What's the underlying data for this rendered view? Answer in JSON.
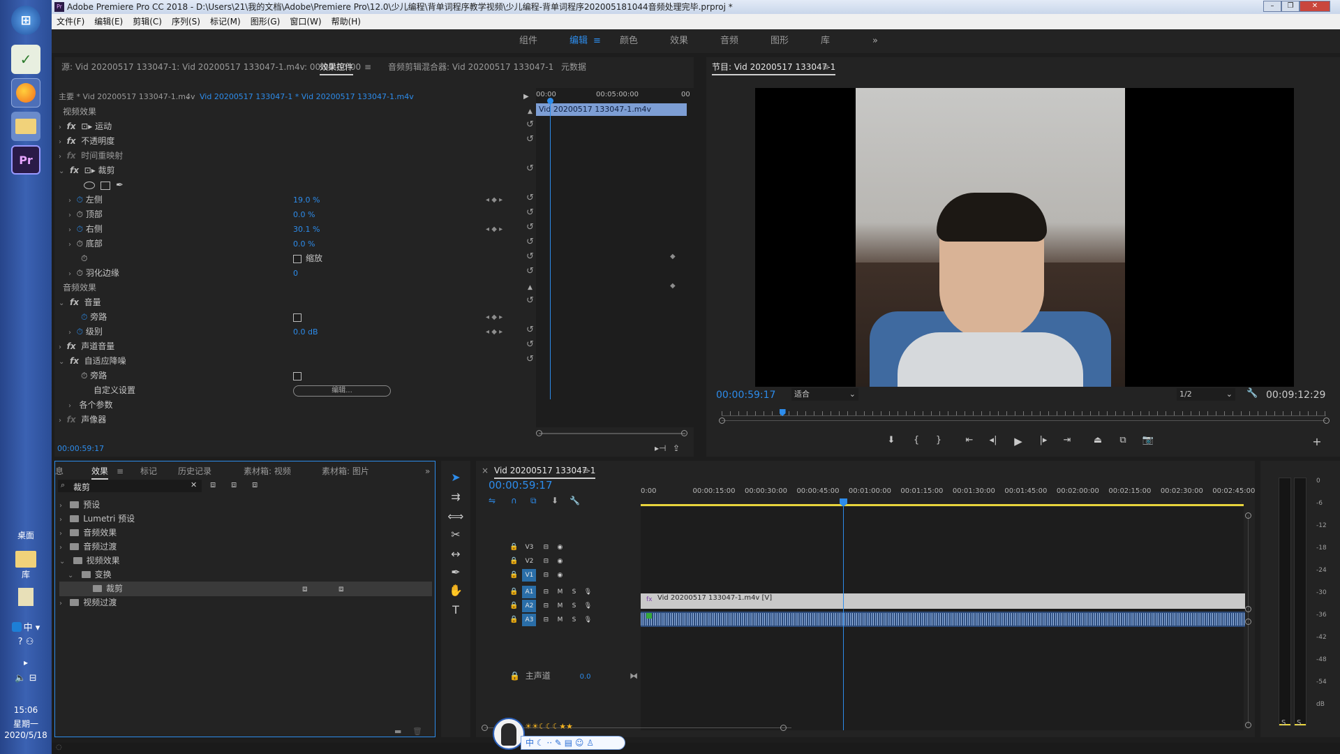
{
  "window": {
    "title": "Adobe Premiere Pro CC 2018 - D:\\Users\\21\\我的文档\\Adobe\\Premiere Pro\\12.0\\少儿编程\\背单词程序教学视频\\少儿编程-背单词程序202005181044音频处理完毕.prproj *",
    "app_icon": "Pr"
  },
  "menu": [
    "文件(F)",
    "编辑(E)",
    "剪辑(C)",
    "序列(S)",
    "标记(M)",
    "图形(G)",
    "窗口(W)",
    "帮助(H)"
  ],
  "workspaces": [
    "组件",
    "编辑",
    "颜色",
    "效果",
    "音频",
    "图形",
    "库"
  ],
  "workspace_active": "编辑",
  "workspace_more": "»",
  "source_tabs": {
    "source": "源: Vid 20200517 133047-1: Vid 20200517 133047-1.m4v: 00:00:00:00",
    "effect_controls": "效果控件",
    "audio_mixer": "音频剪辑混合器: Vid 20200517 133047-1",
    "metadata": "元数据",
    "menu_icon": "≡"
  },
  "effect_controls": {
    "master": "主要 * Vid 20200517 133047-1.m4v",
    "sequence_clip": "Vid 20200517 133047-1 * Vid 20200517 133047-1.m4v",
    "mini_time_start": "00:00",
    "mini_time_mid": "00:05:00:00",
    "mini_time_end": "00",
    "mini_clip": "Vid 20200517 133047-1.m4v",
    "video_effects": "视频效果",
    "motion": "运动",
    "opacity": "不透明度",
    "time_remap": "时间重映射",
    "crop": "裁剪",
    "left_label": "左侧",
    "left_value": "19.0 %",
    "top_label": "顶部",
    "top_value": "0.0 %",
    "right_label": "右侧",
    "right_value": "30.1 %",
    "bottom_label": "底部",
    "bottom_value": "0.0 %",
    "zoom_label": "缩放",
    "feather_label": "羽化边缘",
    "feather_value": "0",
    "audio_effects": "音频效果",
    "volume": "音量",
    "bypass_label": "旁路",
    "level_label": "级别",
    "level_value": "0.0 dB",
    "channel_volume": "声道音量",
    "denoise": "自适应降噪",
    "bypass2_label": "旁路",
    "custom_setup": "自定义设置",
    "edit_button": "编辑...",
    "params": "各个参数",
    "vocoder": "声像器",
    "footer_time": "00:00:59:17"
  },
  "program": {
    "title": "节目: Vid 20200517 133047-1",
    "timecode": "00:00:59:17",
    "fit": "适合",
    "resolution": "1/2",
    "duration": "00:09:12:29",
    "playhead_fraction": 0.1
  },
  "effects_panel": {
    "tabs": [
      "息",
      "效果",
      "标记",
      "历史记录",
      "素材箱: 视频",
      "素材箱: 图片"
    ],
    "active_tab": "效果",
    "more": "»",
    "search_value": "裁剪",
    "tree": [
      {
        "label": "预设",
        "level": 0,
        "open": false
      },
      {
        "label": "Lumetri 预设",
        "level": 0,
        "open": false
      },
      {
        "label": "音频效果",
        "level": 0,
        "open": false
      },
      {
        "label": "音频过渡",
        "level": 0,
        "open": false
      },
      {
        "label": "视频效果",
        "level": 0,
        "open": true
      },
      {
        "label": "变换",
        "level": 1,
        "open": true
      },
      {
        "label": "裁剪",
        "level": 2,
        "open": false
      },
      {
        "label": "视频过渡",
        "level": 0,
        "open": false
      }
    ]
  },
  "timeline": {
    "title": "Vid 20200517 133047-1",
    "timecode": "00:00:59:17",
    "ruler": [
      "0:00",
      "00:00:15:00",
      "00:00:30:00",
      "00:00:45:00",
      "00:01:00:00",
      "00:01:15:00",
      "00:01:30:00",
      "00:01:45:00",
      "00:02:00:00",
      "00:02:15:00",
      "00:02:30:00",
      "00:02:45:00"
    ],
    "tracks_video": [
      "V3",
      "V2",
      "V1"
    ],
    "tracks_audio": [
      "A1",
      "A2",
      "A3"
    ],
    "master_label": "主声道",
    "master_value": "0.0",
    "clip_label": "Vid 20200517 133047-1.m4v [V]",
    "mute": "M",
    "solo": "S"
  },
  "meter": {
    "labels": [
      "0",
      "-6",
      "-12",
      "-18",
      "-24",
      "-30",
      "-36",
      "-42",
      "-48",
      "-54",
      "dB"
    ],
    "solo_left": "S",
    "solo_right": "S"
  },
  "taskbar": {
    "desktop": "桌面",
    "library": "库",
    "ime": "中",
    "time": "15:06",
    "weekday": "星期一",
    "date": "2020/5/18"
  },
  "ime_toolbar": {
    "lang": "中",
    "stars": "☀☀☾☾☾★★"
  },
  "colors": {
    "accent": "#2d8ceb",
    "panel": "#232323",
    "timeline_yellow": "#e8d43c",
    "taskbar": "#3b62b3"
  }
}
